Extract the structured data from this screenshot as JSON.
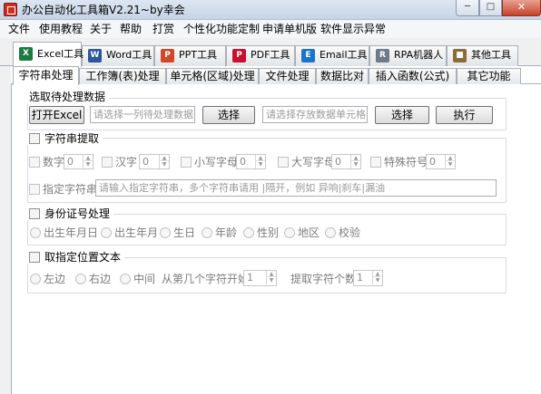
{
  "window": {
    "title": "办公自动化工具箱V2.21~by幸会",
    "min_glyph": "─",
    "max_glyph": "□",
    "close_glyph": "✕"
  },
  "menu": [
    "文件",
    "使用教程",
    "关于",
    "帮助",
    "打赏",
    "个性化功能定制",
    "申请单机版",
    "软件显示异常"
  ],
  "tool_tabs": [
    {
      "label": "Excel工具",
      "icon": "excel-icon",
      "glyph": "X",
      "color": "#1f7a3f"
    },
    {
      "label": "Word工具",
      "icon": "word-icon",
      "glyph": "W",
      "color": "#2b579a"
    },
    {
      "label": "PPT工具",
      "icon": "ppt-icon",
      "glyph": "P",
      "color": "#d24726"
    },
    {
      "label": "PDF工具",
      "icon": "pdf-icon",
      "glyph": "P",
      "color": "#c8102e"
    },
    {
      "label": "Email工具",
      "icon": "email-icon",
      "glyph": "E",
      "color": "#1a73c9"
    },
    {
      "label": "RPA机器人",
      "icon": "robot-icon",
      "glyph": "R",
      "color": "#6d7a8a"
    },
    {
      "label": "其他工具",
      "icon": "folder-icon",
      "glyph": "■",
      "color": "#8a6d3b"
    }
  ],
  "sub_tabs": [
    "字符串处理",
    "工作簿(表)处理",
    "单元格(区域)处理",
    "文件处理",
    "数据比对",
    "插入函数(公式)",
    "其它功能"
  ],
  "select_group": {
    "title": "选取待处理数据",
    "open_excel_label": "打开Excel",
    "source_placeholder": "请选择一列待处理数据",
    "select1_label": "选择",
    "target_placeholder": "请选择存放数据单元格",
    "select2_label": "选择",
    "execute_label": "执行"
  },
  "extract_group": {
    "title": "字符串提取",
    "options": [
      {
        "label": "数字",
        "value": "0"
      },
      {
        "label": "汉字",
        "value": "0"
      },
      {
        "label": "小写字母",
        "value": "0"
      },
      {
        "label": "大写字母",
        "value": "0"
      },
      {
        "label": "特殊符号",
        "value": "0"
      }
    ],
    "custom_label": "指定字符串",
    "custom_placeholder": "请输入指定字符串，多个字符串请用 |隔开，例如 异响|刹车|漏油"
  },
  "id_group": {
    "title": "身份证号处理",
    "options": [
      "出生年月日",
      "出生年月",
      "生日",
      "年龄",
      "性别",
      "地区",
      "校验"
    ]
  },
  "position_group": {
    "title": "取指定位置文本",
    "options": [
      "左边",
      "右边",
      "中间"
    ],
    "start_label": "从第几个字符开始:",
    "start_value": "1",
    "count_label": "提取字符个数:",
    "count_value": "1"
  }
}
